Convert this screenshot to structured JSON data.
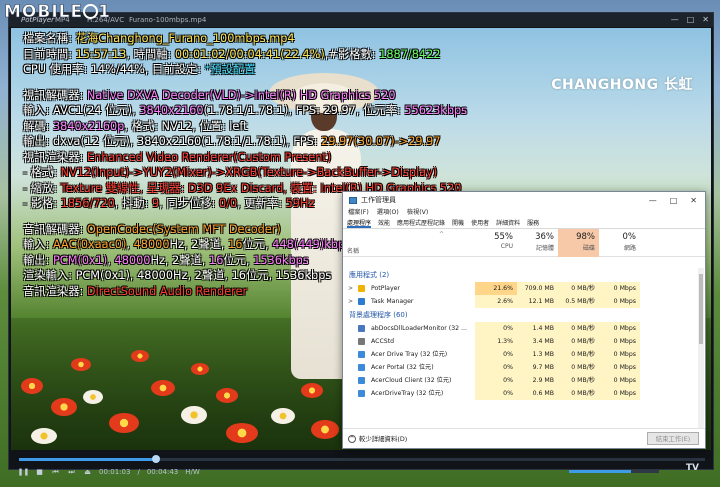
{
  "watermark": {
    "text_before": "MOBILE",
    "text_after": "1"
  },
  "player": {
    "brand": "PotPlayer",
    "menu": [
      "MP4",
      "H.264/AVC"
    ],
    "file_title": "Furano-100mbps.mp4",
    "video_logo": "CHANGHONG 长虹",
    "osd": {
      "file_label": "檔案名稱: ",
      "file_value": "花海Changhong_Furano_100mbps.mp4",
      "time_label": "目前時間: ",
      "time_value": "15:57:13",
      "timeline_label": ", 時間軸: ",
      "timeline_value": "00:01:02/00:04:41(22.4%)",
      "frames_label": ",#影格數: ",
      "frames_value": "1887/8422",
      "cpu_label": "CPU 使用率: 14%/44%, 目前設定: ",
      "cpu_value": "*預設配置",
      "vdec_label": "視訊解碼器: ",
      "vdec_value": "Native DXVA Decoder(VLD)->Intel(R) HD Graphics 520",
      "in_label": "輸入: AVC1(24 位元), ",
      "in_res": "3840x2160",
      "in_mid": "(1.78:1/1.78:1), FPS: 29.97, 位元率: ",
      "in_bitrate": "55623kbps",
      "dec_label": "解碼: ",
      "dec_res": "3840x2160p",
      "dec_rest": ", 格式: NV12, 位置: left",
      "out_label": "輸出: dxva(12 位元), 3840x2160(1.78:1/1.78:1), FPS: ",
      "out_fps": "29.97(30.07)->29.97",
      "vrend_label": "視訊渲染器: ",
      "vrend_value": "Enhanced Video Renderer(Custom Present)",
      "fmt_label": " - 格式: ",
      "fmt_value": "NV12(Input)->YUY2(Mixer)->XRGB(Texture->BackBuffer->Display)",
      "scale_label": " - 縮放: ",
      "scale_value": "Texture 雙線性",
      "scale_rest": ", 呈現器: D3D 9Ex Discard, 裝置: Intel(R) HD Graphics 520",
      "frame_label": " - 影格: ",
      "frame_value": "1856/720",
      "jitter_label": ", 抖動: ",
      "jitter_value": "9",
      "sync_label": ", 同步位移: ",
      "sync_value": "0/0",
      "refresh_label": ", 更新率: ",
      "refresh_value": "59Hz",
      "adec_label": "音訊解碼器: ",
      "adec_value": "OpenCodec(System MFT Decoder)",
      "ain_label": "輸入: ",
      "ain_codec": "AAC(0xaac0)",
      "ain_rest1": ", ",
      "ain_rate": "48000",
      "ain_rest2": "Hz, 2聲道, ",
      "ain_bits": "16",
      "ain_rest3": "位元, ",
      "ain_kbps": "448(449)kbps",
      "aout_label": "輸出: ",
      "aout_codec": "PCM(0x1)",
      "aout_rest1": ", ",
      "aout_rate": "48000",
      "aout_rest2": "Hz, 2聲道, ",
      "aout_bits": "16",
      "aout_rest3": "位元, ",
      "aout_kbps": "1536kbps",
      "rin_label": "渲染輸入: PCM(0x1), 48000Hz, 2聲道, 16位元, 1536kbps",
      "arend_label": "音訊渲染器: ",
      "arend_value": "DirectSound Audio Renderer"
    },
    "controls": {
      "elapsed": "00:01:03",
      "duration": "00:04:43",
      "codec": "H/W",
      "progress_fraction": 0.2,
      "volume_fraction": 0.69,
      "tv_badge": "TV"
    }
  },
  "taskmanager": {
    "title": "工作管理員",
    "menu": [
      "檔案(F)",
      "選項(O)",
      "檢視(V)"
    ],
    "tabs": [
      "處理程序",
      "效能",
      "應用程式歷程記錄",
      "開機",
      "使用者",
      "詳細資料",
      "服務"
    ],
    "header": {
      "name": "名稱",
      "cpu_pct": "55%",
      "cpu_label": "CPU",
      "mem_pct": "36%",
      "mem_label": "記憶體",
      "disk_pct": "98%",
      "disk_label": "磁碟",
      "net_pct": "0%",
      "net_label": "網路"
    },
    "group_apps": "應用程式 (2)",
    "apps": [
      {
        "name": "PotPlayer",
        "cpu": "21.6%",
        "mem": "709.0 MB",
        "disk": "0 MB/秒",
        "net": "0 Mbps",
        "color": "#f0b400"
      },
      {
        "name": "Task Manager",
        "cpu": "2.6%",
        "mem": "12.1 MB",
        "disk": "0.5 MB/秒",
        "net": "0 Mbps",
        "color": "#2e7bcf"
      }
    ],
    "group_bg": "背景處理程序 (60)",
    "bg": [
      {
        "name": "abDocsDllLoaderMonitor (32 ...",
        "cpu": "0%",
        "mem": "1.4 MB",
        "disk": "0 MB/秒",
        "net": "0 Mbps",
        "color": "#4a78c0"
      },
      {
        "name": "ACCStd",
        "cpu": "1.3%",
        "mem": "3.4 MB",
        "disk": "0 MB/秒",
        "net": "0 Mbps",
        "color": "#777777"
      },
      {
        "name": "Acer Drive Tray (32 位元)",
        "cpu": "0%",
        "mem": "1.3 MB",
        "disk": "0 MB/秒",
        "net": "0 Mbps",
        "color": "#3c8ad9"
      },
      {
        "name": "Acer Portal (32 位元)",
        "cpu": "0%",
        "mem": "9.7 MB",
        "disk": "0 MB/秒",
        "net": "0 Mbps",
        "color": "#3c8ad9"
      },
      {
        "name": "AcerCloud Client (32 位元)",
        "cpu": "0%",
        "mem": "2.9 MB",
        "disk": "0 MB/秒",
        "net": "0 Mbps",
        "color": "#3c8ad9"
      },
      {
        "name": "AcerDriveTray (32 位元)",
        "cpu": "0%",
        "mem": "0.6 MB",
        "disk": "0 MB/秒",
        "net": "0 Mbps",
        "color": "#3c8ad9"
      }
    ],
    "fewer_details": "較少詳細資料(D)",
    "end_task": "結束工作(E)"
  }
}
